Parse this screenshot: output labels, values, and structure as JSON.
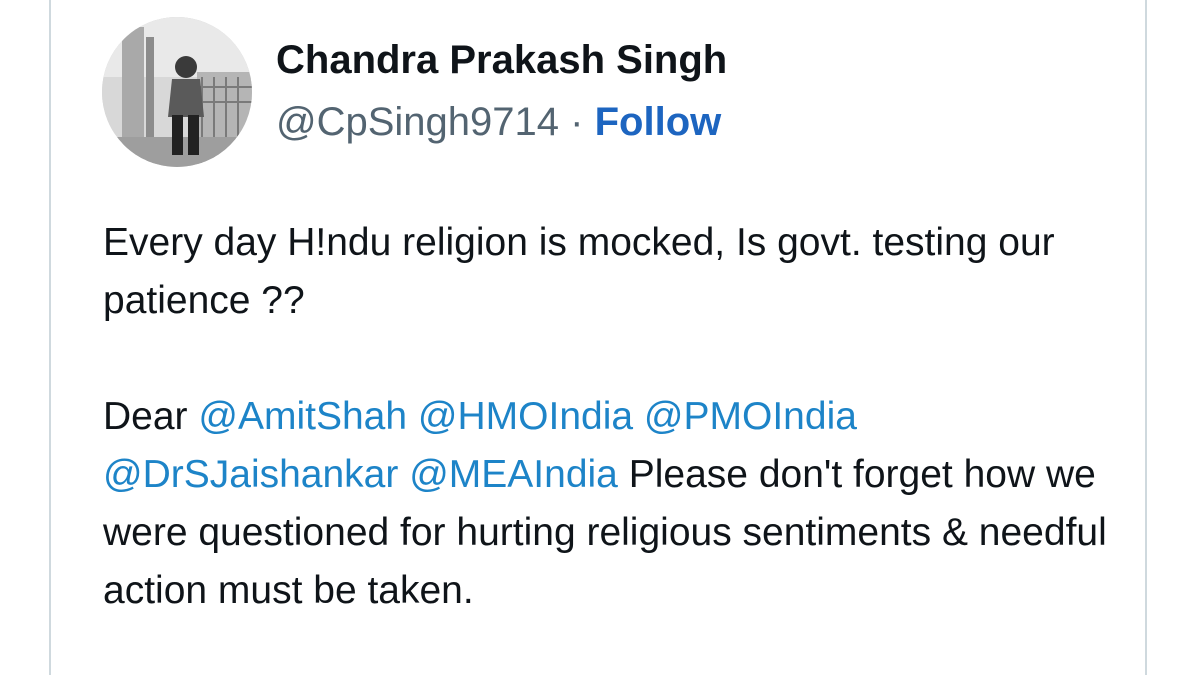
{
  "author": {
    "display_name": "Chandra Prakash Singh",
    "handle": "@CpSingh9714",
    "separator": "·",
    "follow_label": "Follow"
  },
  "tweet": {
    "paragraph1": "Every day H!ndu religion is mocked, Is govt. testing our patience ??",
    "salutation": "Dear",
    "mentions": [
      "@AmitShah",
      "@HMOIndia",
      "@PMOIndia",
      "@DrSJaishankar",
      "@MEAIndia"
    ],
    "tail": "Please don't forget how we were questioned for hurting religious sentiments & needful action must be taken."
  },
  "colors": {
    "link": "#1d84c8",
    "follow": "#1d65c0",
    "text": "#0f1419",
    "muted": "#536471"
  }
}
